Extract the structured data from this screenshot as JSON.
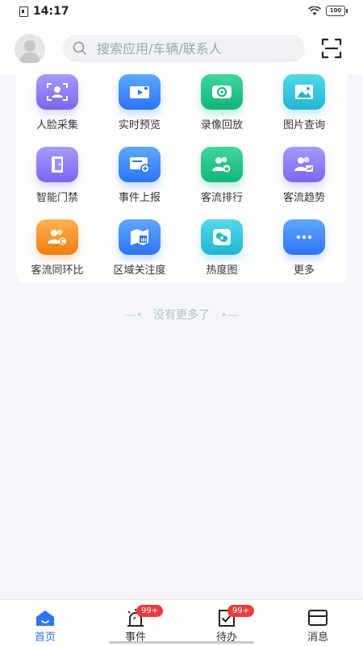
{
  "status_bar": {
    "time": "14:17",
    "battery": "100"
  },
  "header": {
    "search_placeholder": "搜索应用/车辆/联系人"
  },
  "apps": [
    {
      "label": "人脸采集",
      "icon": "face-capture-icon",
      "color": "purple"
    },
    {
      "label": "实时预览",
      "icon": "video-camera-icon",
      "color": "blue"
    },
    {
      "label": "录像回放",
      "icon": "playback-icon",
      "color": "green"
    },
    {
      "label": "图片查询",
      "icon": "image-icon",
      "color": "cyan"
    },
    {
      "label": "智能门禁",
      "icon": "door-icon",
      "color": "purple"
    },
    {
      "label": "事件上报",
      "icon": "event-report-icon",
      "color": "blue"
    },
    {
      "label": "客流排行",
      "icon": "people-rank-icon",
      "color": "green"
    },
    {
      "label": "客流趋势",
      "icon": "people-trend-icon",
      "color": "purple"
    },
    {
      "label": "客流同环比",
      "icon": "people-compare-icon",
      "color": "orange"
    },
    {
      "label": "区域关注度",
      "icon": "area-attention-icon",
      "color": "blue"
    },
    {
      "label": "热度图",
      "icon": "heatmap-icon",
      "color": "cyan"
    },
    {
      "label": "更多",
      "icon": "more-icon",
      "color": "blue"
    }
  ],
  "no_more_text": "没有更多了",
  "tabbar": [
    {
      "label": "首页",
      "icon": "home-icon",
      "active": true
    },
    {
      "label": "事件",
      "icon": "alarm-icon",
      "badge": "99+"
    },
    {
      "label": "待办",
      "icon": "todo-icon",
      "badge": "99+"
    },
    {
      "label": "消息",
      "icon": "message-icon"
    }
  ],
  "colors": {
    "accent": "#2d74f5",
    "badge": "#f03b3b",
    "background": "#f4f6fb"
  }
}
